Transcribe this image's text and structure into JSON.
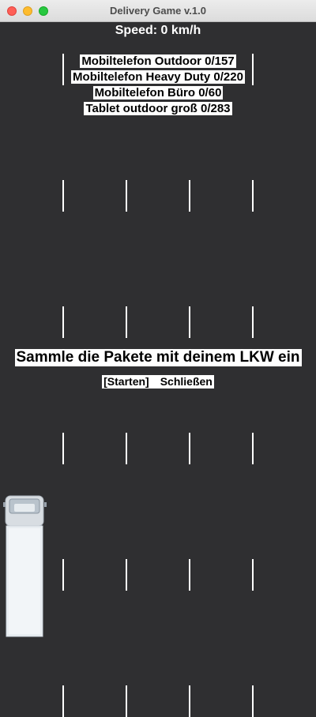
{
  "window": {
    "title": "Delivery Game v.1.0"
  },
  "hud": {
    "speed": "Speed: 0 km/h"
  },
  "inventory": [
    {
      "label": "Mobiltelefon Outdoor 0/157"
    },
    {
      "label": "Mobiltelefon Heavy Duty 0/220"
    },
    {
      "label": "Mobiltelefon Büro 0/60"
    },
    {
      "label": "Tablet outdoor groß 0/283"
    }
  ],
  "message": "Sammle die Pakete mit deinem LKW ein",
  "menu": {
    "start_label": "[Starten]",
    "close_label": "Schließen"
  },
  "colors": {
    "road": "#2f2f31",
    "lane_marking": "#ffffff",
    "label_bg": "#ffffff"
  }
}
